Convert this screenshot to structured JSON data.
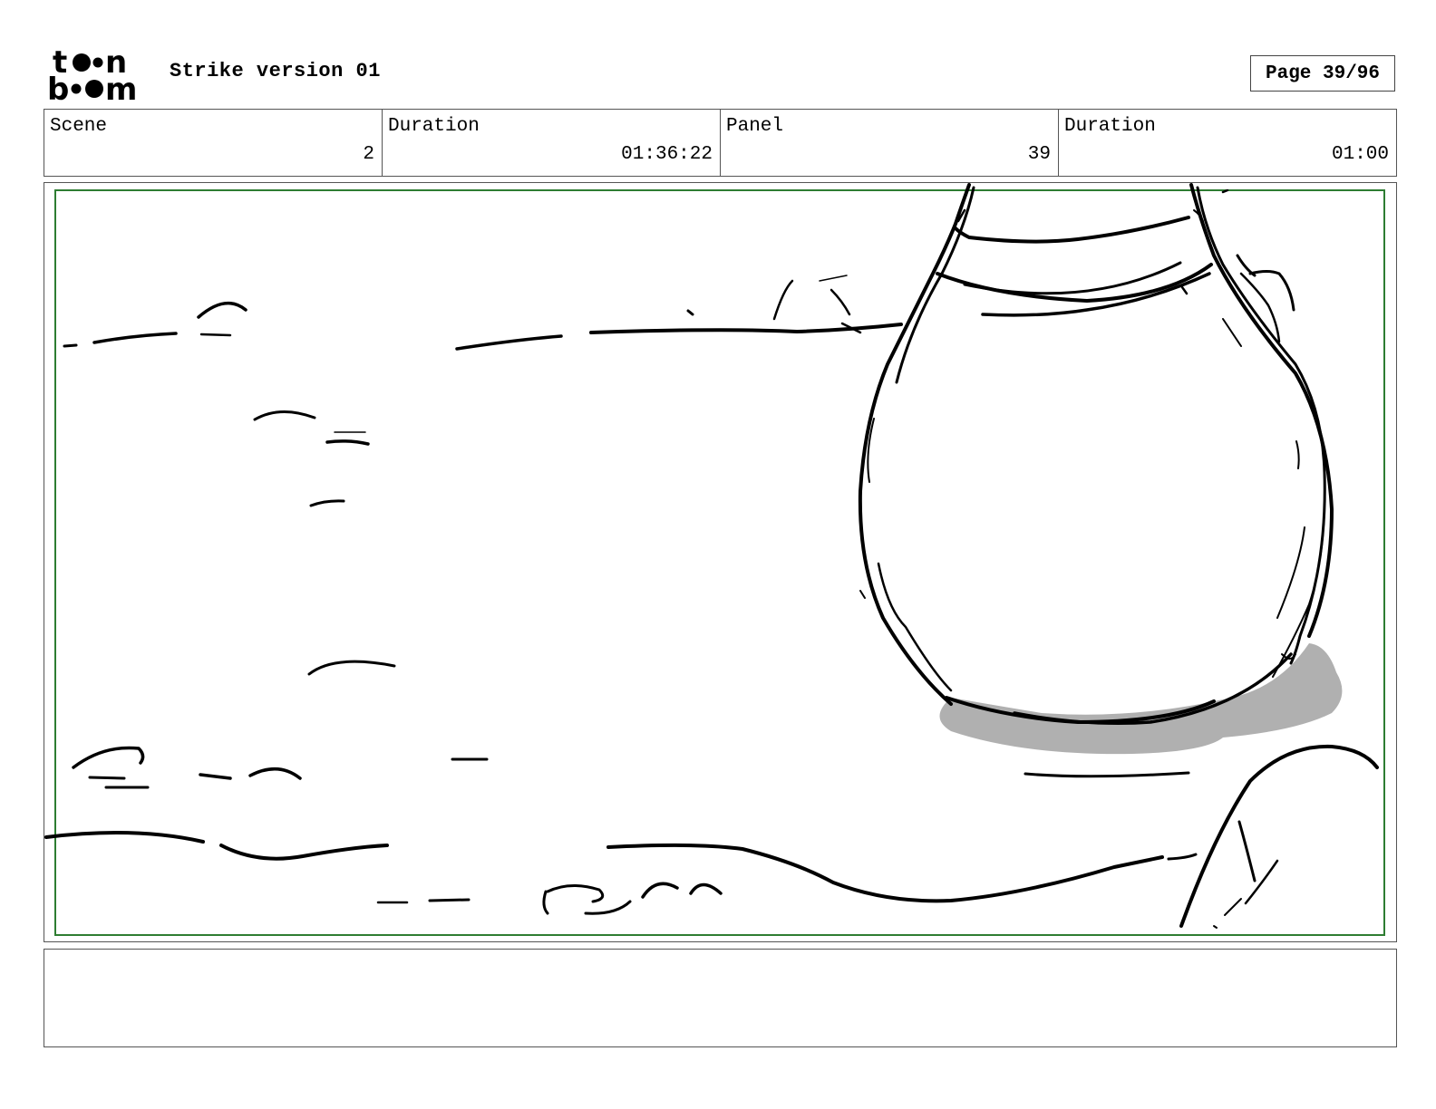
{
  "header": {
    "logo_text": "toonboom",
    "title": "Strike version 01",
    "page": "Page 39/96"
  },
  "info": {
    "scene_label": "Scene",
    "scene_value": "2",
    "scene_duration_label": "Duration",
    "scene_duration_value": "01:36:22",
    "panel_label": "Panel",
    "panel_value": "39",
    "panel_duration_label": "Duration",
    "panel_duration_value": "01:00"
  },
  "notes": {
    "text": ""
  },
  "colors": {
    "safe_frame": "#2e7d32",
    "shadow": "#b0b0b0",
    "line": "#000000"
  }
}
